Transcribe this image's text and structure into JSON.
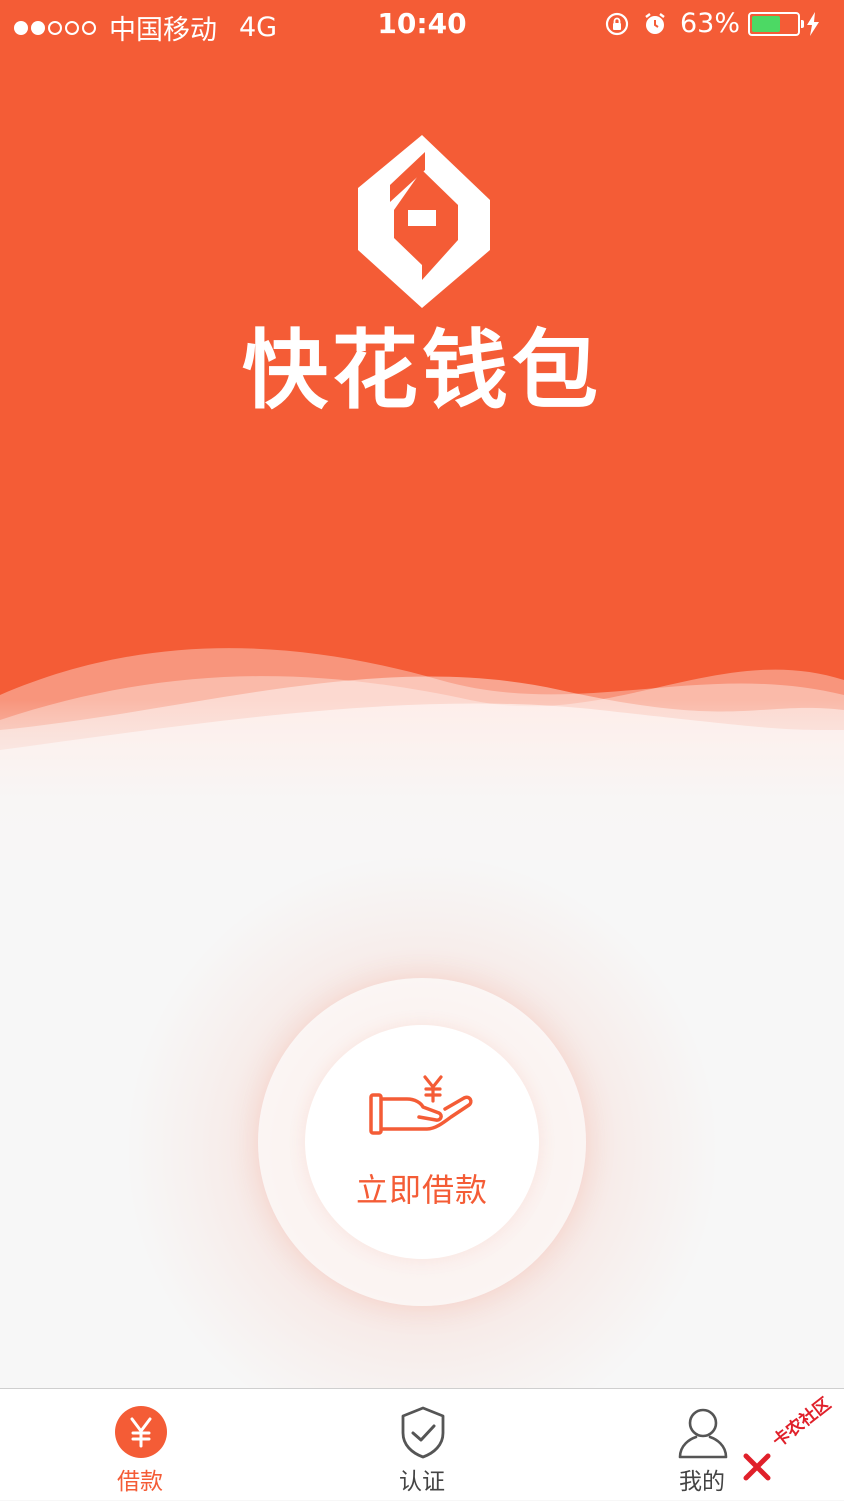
{
  "status_bar": {
    "carrier": "中国移动",
    "network": "4G",
    "time": "10:40",
    "battery_percent": "63%",
    "battery_level": 0.63,
    "signal_bars_filled": 2,
    "signal_bars_total": 5
  },
  "brand": {
    "name": "快花钱包",
    "logo_icon": "diamond-logo-icon"
  },
  "main": {
    "borrow_button_label": "立即借款",
    "borrow_icon": "hand-yen-icon"
  },
  "tabbar": {
    "tabs": [
      {
        "label": "借款",
        "icon": "yen-circle-icon",
        "active": true
      },
      {
        "label": "认证",
        "icon": "shield-check-icon",
        "active": false
      },
      {
        "label": "我的",
        "icon": "user-icon",
        "active": false
      }
    ]
  },
  "watermark": {
    "text": "卡农社区"
  },
  "colors": {
    "brand_orange": "#f45c36",
    "background": "#f7f7f7",
    "battery_green": "#4cd964"
  }
}
